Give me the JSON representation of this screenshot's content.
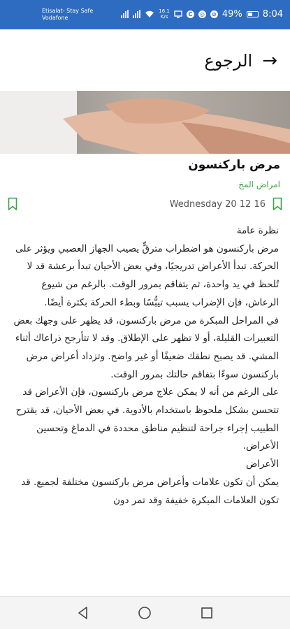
{
  "status_bar": {
    "carrier_line1": "Etisalat- Stay Safe",
    "carrier_line2": "Vodafone",
    "net_speed": "16.1",
    "net_unit": "K/s",
    "battery": "49%",
    "time": "8:04"
  },
  "header": {
    "back_label": "الرجوع"
  },
  "article": {
    "title": "مرض باركنسون",
    "category": "امراض المخ",
    "date": "Wednesday 20 12 16",
    "paragraphs": [
      "نظرة عامة",
      "مرض باركنسون هو اضطراب مترقٍّ يصيب الجهاز العصبي ويؤثر على الحركة. تبدأ الأعراض تدريجيًا، وفي بعض الأحيان تبدأ برعشة قد لا تُلحظ في يد واحدة، ثم يتفاقم بمرور الوقت. بالرغم من شيوع الرعاش، فإن الإضراب يسبب تيبُّسًا وبطء الحركة بكثرة أيضًا.",
      "في المراحل المبكرة من مرض باركنسون، قد يظهر على وجهك بعض التعبيرات القليلة، أو لا تظهر على الإطلاق. وقد لا تتأرجح ذراعاك أثناء المشي. قد يصبح نطقك ضعيفًا أو غير واضح. وتزداد أعراض مرض باركنسون سوءًا بتفاقم حالتك بمرور الوقت.",
      "على الرغم من أنه لا يمكن علاج مرض باركنسون، فإن الأعراض قد تتحسن بشكل ملحوظ باستخدام بالأدوية. في بعض الأحيان، قد يقترح الطبيب إجراء جراحة لتنظيم مناطق محددة في الدماغ وتحسين الأعراض.",
      "الأعراض",
      "يمكن أن تكون علامات وأعراض مرض باركنسون مختلفة لجميع. قد تكون العلامات المبكرة خفيفة وقد تمر دون"
    ]
  }
}
